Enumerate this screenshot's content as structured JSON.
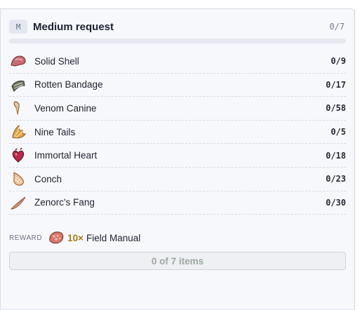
{
  "request": {
    "badge": "M",
    "title": "Medium request",
    "count": "0/7",
    "progress_fraction": 0
  },
  "items": [
    {
      "name": "Solid Shell",
      "count": "0/9",
      "icon": "shell-icon"
    },
    {
      "name": "Rotten Bandage",
      "count": "0/17",
      "icon": "bandage-icon"
    },
    {
      "name": "Venom Canine",
      "count": "0/58",
      "icon": "canine-icon"
    },
    {
      "name": "Nine Tails",
      "count": "0/5",
      "icon": "tails-icon"
    },
    {
      "name": "Immortal Heart",
      "count": "0/18",
      "icon": "heart-icon"
    },
    {
      "name": "Conch",
      "count": "0/23",
      "icon": "conch-icon"
    },
    {
      "name": "Zenorc's Fang",
      "count": "0/30",
      "icon": "fang-icon"
    }
  ],
  "reward": {
    "label": "REWARD",
    "quantity": "10×",
    "name": "Field Manual",
    "icon": "field-manual-icon"
  },
  "submit": {
    "label": "0 of 7 items"
  },
  "colors": {
    "reward_quantity": "#a67a12",
    "progress_fill": "#8aa0d8",
    "submit_text": "#9ea8a0"
  }
}
